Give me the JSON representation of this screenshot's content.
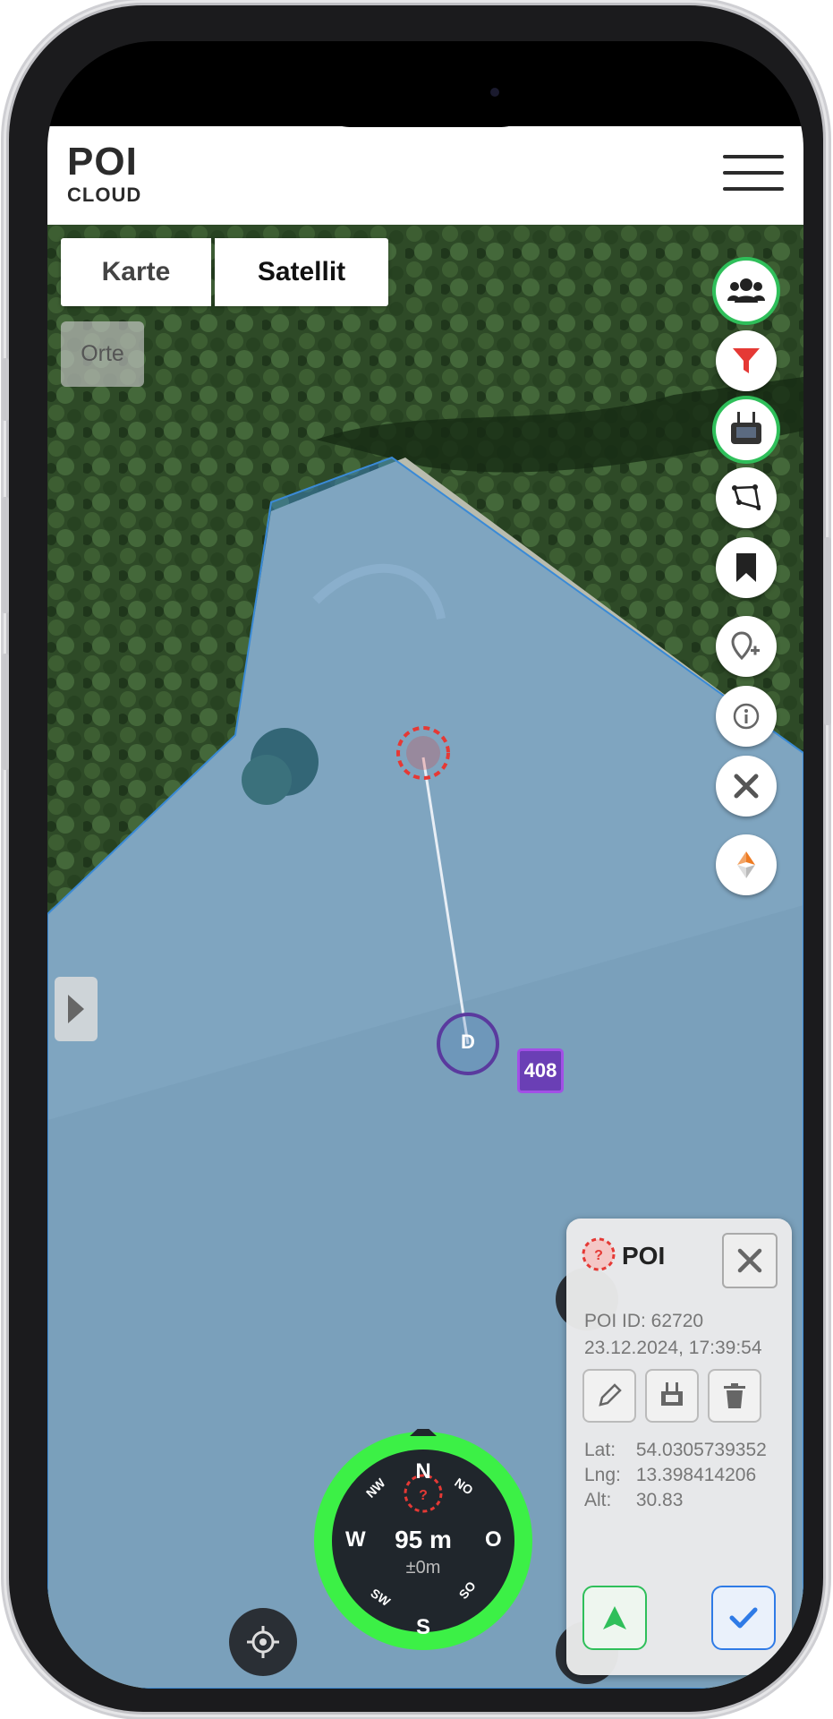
{
  "app": {
    "logo_top": "POI",
    "logo_bottom": "CLOUD"
  },
  "map": {
    "type_buttons": [
      "Karte",
      "Satellit"
    ],
    "places_label": "Orte",
    "marker_badge": "408",
    "drone_marker_label": "D"
  },
  "right_toolbar": [
    {
      "icon": "users-icon",
      "state": "active"
    },
    {
      "icon": "filter-icon",
      "state": "active"
    },
    {
      "icon": "remote-controller-icon",
      "state": "active"
    },
    {
      "icon": "polygon-icon"
    },
    {
      "icon": "bookmark-icon"
    },
    {
      "icon": "add-location-icon"
    },
    {
      "icon": "info-icon"
    },
    {
      "icon": "close-icon"
    },
    {
      "icon": "compass-orientation-icon"
    }
  ],
  "poi_card": {
    "title": "POI",
    "id_line": "POI ID: 62720",
    "timestamp": "23.12.2024, 17:39:54",
    "lat_label": "Lat:",
    "lat_value": "54.0305739352",
    "lng_label": "Lng:",
    "lng_value": "13.398414206",
    "alt_label": "Alt:",
    "alt_value": "30.83"
  },
  "compass": {
    "distance": "95 m",
    "accuracy": "±0m",
    "directions": {
      "n": "N",
      "no": "NO",
      "o": "O",
      "so": "SO",
      "s": "S",
      "sw": "SW",
      "w": "W",
      "nw": "NW"
    }
  },
  "colors": {
    "accent_green": "#2fbf5a",
    "compass_green": "#3cf046",
    "poi_red": "#e53935",
    "badge_purple": "#6a3fb5",
    "polygon_blue": "#3a8ad6"
  }
}
